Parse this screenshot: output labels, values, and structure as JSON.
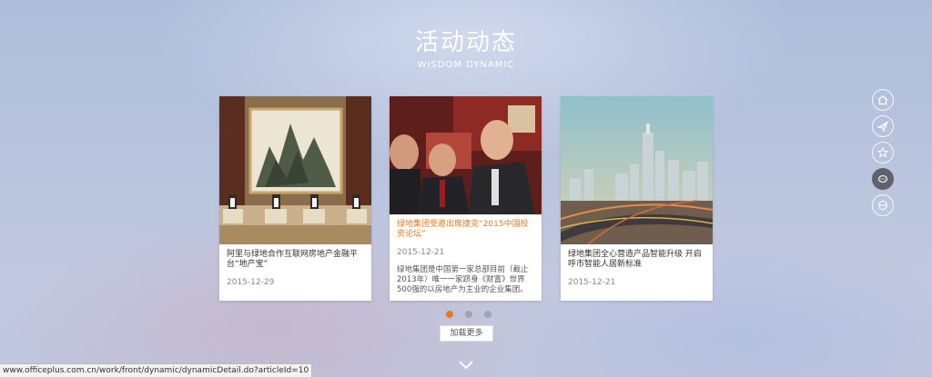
{
  "header": {
    "title": "活动动态",
    "subtitle": "WISDOM DYNAMIC"
  },
  "cards": [
    {
      "title": "阿里与绿地合作互联网房地产金融平台“地产宝”",
      "date": "2015-12-29",
      "excerpt": ""
    },
    {
      "title": "绿地集团受邀出席捷克“2015中国投资论坛”",
      "date": "2015-12-21",
      "excerpt": "绿地集团是中国第一家总部目前（截止2013年）唯一一家跻身《财富》世界500强的以房地产为主业的企业集团。"
    },
    {
      "title": "绿地集团全心营造产品智能升级 开启呼市智能人居新标准",
      "date": "2015-12-21",
      "excerpt": ""
    }
  ],
  "pager": {
    "count": 3,
    "active_index": 0
  },
  "load_more_label": "加载更多",
  "side_nav": [
    "home-icon",
    "plane-icon",
    "star-icon",
    "chat-icon",
    "globe-icon"
  ],
  "status_url": "www.officeplus.com.cn/work/front/dynamic/dynamicDetail.do?articleId=10",
  "colors": {
    "accent": "#e8791e",
    "nav_active": "#5f626c"
  }
}
